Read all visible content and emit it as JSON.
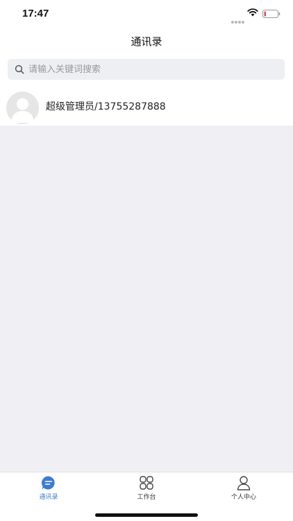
{
  "status_bar": {
    "time": "17:47",
    "icons": [
      "signal-icon",
      "wifi-icon",
      "battery-icon"
    ]
  },
  "header": {
    "title": "通讯录"
  },
  "search": {
    "placeholder": "请输入关键词搜索",
    "value": ""
  },
  "contacts": [
    {
      "name": "超级管理员/13755287888",
      "avatar": "default-avatar-icon"
    }
  ],
  "tab_bar": {
    "active_color": "#3a7bd5",
    "items": [
      {
        "label": "通讯录",
        "icon": "chat-bubble-icon",
        "active": true
      },
      {
        "label": "工作台",
        "icon": "grid-icon",
        "active": false
      },
      {
        "label": "个人中心",
        "icon": "person-icon",
        "active": false
      }
    ]
  }
}
